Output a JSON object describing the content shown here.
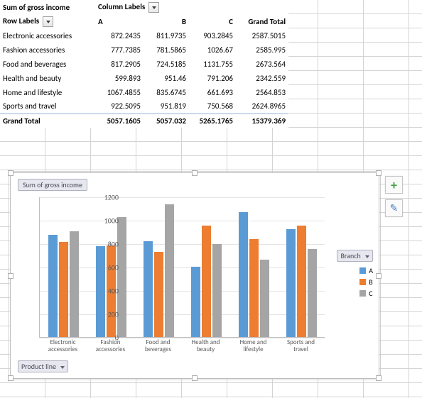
{
  "pivot": {
    "measure_label": "Sum of gross income",
    "columns_label": "Column Labels",
    "rows_label": "Row Labels",
    "col_headers": [
      "A",
      "B",
      "C",
      "Grand Total"
    ],
    "rows": [
      {
        "label": "Electronic accessories",
        "vals": [
          "872.2435",
          "811.9735",
          "903.2845",
          "2587.5015"
        ]
      },
      {
        "label": "Fashion accessories",
        "vals": [
          "777.7385",
          "781.5865",
          "1026.67",
          "2585.995"
        ]
      },
      {
        "label": "Food and beverages",
        "vals": [
          "817.2905",
          "724.5185",
          "1131.755",
          "2673.564"
        ]
      },
      {
        "label": "Health and beauty",
        "vals": [
          "599.893",
          "951.46",
          "791.206",
          "2342.559"
        ]
      },
      {
        "label": "Home and lifestyle",
        "vals": [
          "1067.4855",
          "835.6745",
          "661.693",
          "2564.853"
        ]
      },
      {
        "label": "Sports and travel",
        "vals": [
          "922.5095",
          "951.819",
          "750.568",
          "2624.8965"
        ]
      }
    ],
    "grand_total_label": "Grand Total",
    "grand_totals": [
      "5057.1605",
      "5057.032",
      "5265.1765",
      "15379.369"
    ]
  },
  "chart_data": {
    "type": "bar",
    "title_pill": "Sum of gross income",
    "legend_filter": "Branch",
    "axis_filter": "Product line",
    "categories": [
      "Electronic accessories",
      "Fashion accessories",
      "Food and beverages",
      "Health and beauty",
      "Home and lifestyle",
      "Sports and travel"
    ],
    "series": [
      {
        "name": "A",
        "color": "#5b9bd5",
        "values": [
          872.2435,
          777.7385,
          817.2905,
          599.893,
          1067.4855,
          922.5095
        ]
      },
      {
        "name": "B",
        "color": "#ed7d31",
        "values": [
          811.9735,
          781.5865,
          724.5185,
          951.46,
          835.6745,
          951.819
        ]
      },
      {
        "name": "C",
        "color": "#a5a5a5",
        "values": [
          903.2845,
          1026.67,
          1131.755,
          791.206,
          661.693,
          750.568
        ]
      }
    ],
    "ylim": [
      0,
      1200
    ],
    "yticks": [
      0,
      200,
      400,
      600,
      800,
      1000,
      1200
    ]
  },
  "side_buttons": {
    "add": "+",
    "format": "✎"
  }
}
